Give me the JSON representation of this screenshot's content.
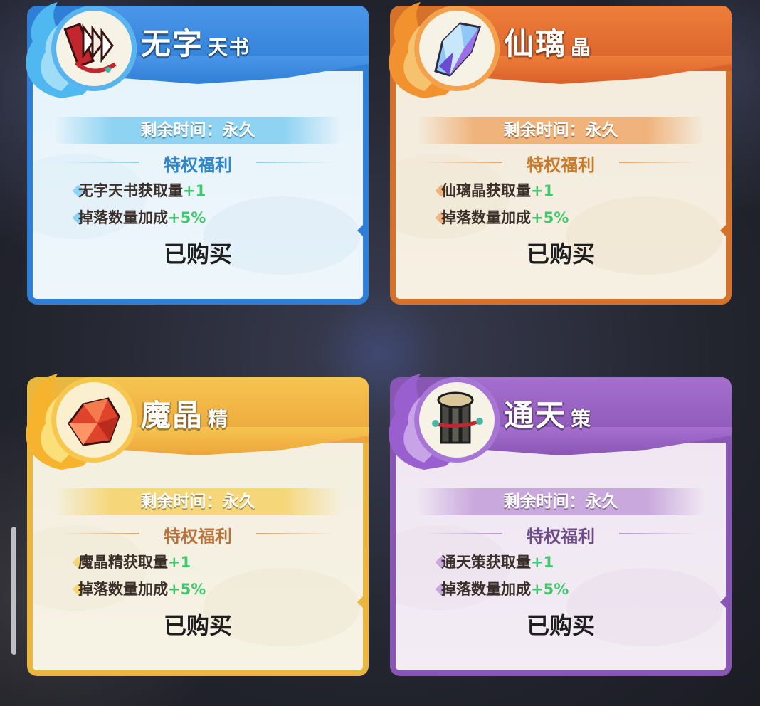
{
  "cards": [
    {
      "title_main": "无字",
      "title_sub": "天书",
      "time_text": "剩余时间：永久",
      "perk_heading": "特权福利",
      "perks": [
        {
          "label": "无字天书获取量",
          "value": "+1"
        },
        {
          "label": "掉落数量加成",
          "value": "+5%"
        }
      ],
      "status": "已购买",
      "icon": "book-scroll-icon",
      "theme": "blue",
      "colors": {
        "frame": "#2f7fd6",
        "header": "#3b8ae0",
        "body": "#e9f4fb",
        "accent": "#8fd3f2",
        "heading": "#2f86c8"
      }
    },
    {
      "title_main": "仙璃",
      "title_sub": "晶",
      "time_text": "剩余时间：永久",
      "perk_heading": "特权福利",
      "perks": [
        {
          "label": "仙璃晶获取量",
          "value": "+1"
        },
        {
          "label": "掉落数量加成",
          "value": "+5%"
        }
      ],
      "status": "已购买",
      "icon": "crystal-icon",
      "theme": "orange",
      "colors": {
        "frame": "#d4722b",
        "header": "#e26b2c",
        "body": "#f6eee0",
        "accent": "#f0b37c",
        "heading": "#c77b2c"
      }
    },
    {
      "title_main": "魔晶",
      "title_sub": "精",
      "time_text": "剩余时间：永久",
      "perk_heading": "特权福利",
      "perks": [
        {
          "label": "魔晶精获取量",
          "value": "+1"
        },
        {
          "label": "掉落数量加成",
          "value": "+5%"
        }
      ],
      "status": "已购买",
      "icon": "red-gem-icon",
      "theme": "gold",
      "colors": {
        "frame": "#e9b640",
        "header": "#f2b544",
        "body": "#f6f1e2",
        "accent": "#f5d77a",
        "heading": "#b5733d"
      }
    },
    {
      "title_main": "通天",
      "title_sub": "策",
      "time_text": "剩余时间：永久",
      "perk_heading": "特权福利",
      "perks": [
        {
          "label": "通天策获取量",
          "value": "+1"
        },
        {
          "label": "掉落数量加成",
          "value": "+5%"
        }
      ],
      "status": "已购买",
      "icon": "bamboo-scroll-icon",
      "theme": "purple",
      "colors": {
        "frame": "#8a56b5",
        "header": "#9a62c4",
        "body": "#f1e8f3",
        "accent": "#c9a8dd",
        "heading": "#6c4b86"
      }
    }
  ]
}
